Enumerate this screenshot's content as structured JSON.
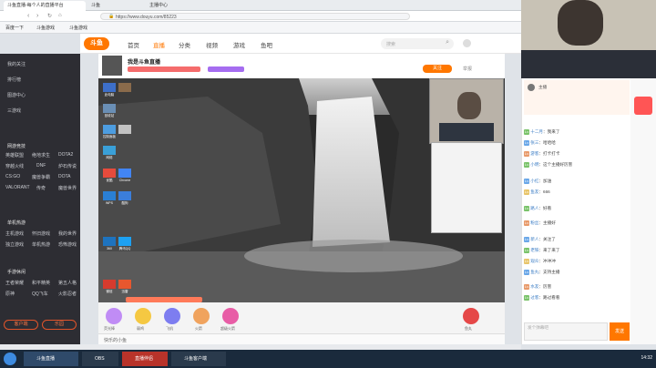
{
  "browser": {
    "tabs": [
      {
        "label": "斗鱼直播-每个人的直播平台"
      },
      {
        "label": "斗鱼"
      },
      {
        "label": "主播中心"
      }
    ],
    "url": "https://www.douyu.com/85223",
    "bookmarks": [
      "百度一下",
      "斗鱼游戏",
      "斗鱼游戏"
    ]
  },
  "site": {
    "logo_text": "斗鱼",
    "nav": [
      "首页",
      "直播",
      "分类",
      "视频",
      "游戏",
      "鱼吧"
    ],
    "search_placeholder": "搜索"
  },
  "sidebar": {
    "top_items": [
      "我的关注",
      "排行榜",
      "图游中心",
      "三游戏"
    ],
    "sections": [
      {
        "title": "网游竞技",
        "items": [
          "英雄联盟",
          "绝地求生",
          "DOTA2",
          "穿越火线",
          "DNF",
          "炉石传说",
          "CS:GO",
          "魔兽争霸",
          "DOTA",
          "VALORANT",
          "传奇",
          "魔兽世界"
        ]
      },
      {
        "title": "单机热游",
        "items": [
          "主机游戏",
          "怀旧游戏",
          "我的世界",
          "独立游戏",
          "单机热游",
          "恐怖游戏"
        ]
      },
      {
        "title": "手游休闲",
        "items": [
          "王者荣耀",
          "和平精英",
          "第五人格",
          "原神",
          "QQ飞车",
          "火影忍者"
        ]
      }
    ],
    "bottom_buttons": [
      "客户端",
      "乐园"
    ]
  },
  "room": {
    "title": "我是斗鱼直播",
    "follow_btn": "关注",
    "report": "举报"
  },
  "desktop_icons": [
    "此电脑",
    "回收站",
    "控制面板",
    "网络",
    "Chrome",
    "酷狗",
    "腾讯QQ",
    "优酷",
    "WPS",
    "迅雷",
    "360",
    "微信"
  ],
  "gift_bar": {
    "gift_names": [
      "荧光棒",
      "弱鸡",
      "飞机",
      "火箭",
      "超级火箭",
      "鱼丸"
    ],
    "bottom_text": "快乐的小鱼"
  },
  "chat": {
    "header_user": "主播",
    "messages": [
      {
        "nick": "十二月",
        "text": "我来了"
      },
      {
        "nick": "张三",
        "text": "哈哈哈"
      },
      {
        "nick": "游客",
        "text": "打卡打卡"
      },
      {
        "nick": "小明",
        "text": "这个主播好厉害"
      },
      {
        "nick": "小红",
        "text": "加油"
      },
      {
        "nick": "鱼友",
        "text": "666"
      },
      {
        "nick": "路人",
        "text": "好看"
      },
      {
        "nick": "粉丝",
        "text": "主播好"
      },
      {
        "nick": "新人",
        "text": "关注了"
      },
      {
        "nick": "老铁",
        "text": "来了来了"
      },
      {
        "nick": "观众",
        "text": "冲冲冲"
      },
      {
        "nick": "鱼丸",
        "text": "支持主播"
      },
      {
        "nick": "水友",
        "text": "厉害"
      },
      {
        "nick": "过客",
        "text": "路过看看"
      }
    ],
    "input_placeholder": "发个弹幕吧",
    "send_btn": "发送"
  },
  "taskbar": {
    "items": [
      "斗鱼直播",
      "OBS",
      "直播伴侣",
      "斗鱼客户端"
    ],
    "clock": "14:32"
  },
  "colors": {
    "accent": "#ff7700",
    "sidebar_bg": "#2d2d33",
    "taskbar_bg": "#1a2a3c"
  }
}
